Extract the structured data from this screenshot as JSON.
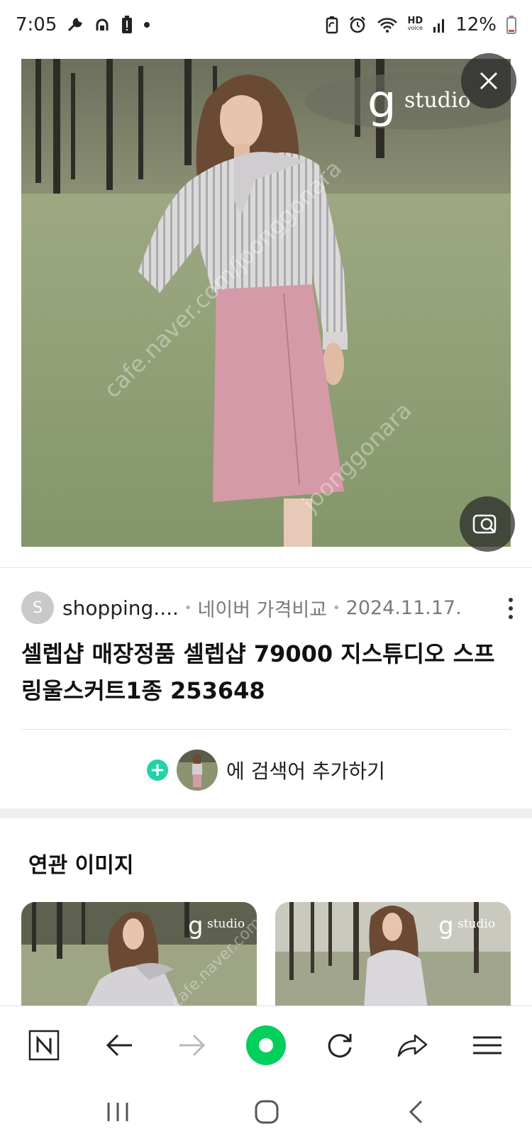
{
  "status_bar": {
    "time": "7:05",
    "battery": "12%",
    "left_icons": [
      "wrench-icon",
      "hotspot-icon",
      "battery-alert-icon",
      "dot-icon"
    ],
    "right_icons": [
      "battery-saver-icon",
      "alarm-icon",
      "wifi-icon",
      "hd-voice-icon",
      "signal-icon",
      "battery-icon"
    ],
    "hd_label": "HD",
    "voice_label": "voice"
  },
  "hero": {
    "brand_logo": "g",
    "brand_text": "studio",
    "watermark_1": "cafe.naver.com/joonggonara",
    "watermark_2": "joonggonara"
  },
  "result": {
    "favicon_letter": "S",
    "site": "shopping....",
    "source": "네이버 가격비교",
    "date": "2024.11.17.",
    "title": "셀렙샵 매장정품 셀렙샵 79000 지스튜디오 스프링울스커트1종 253648"
  },
  "add_search": {
    "label": "에 검색어 추가하기",
    "plus": "+"
  },
  "related": {
    "title": "연관 이미지",
    "brand_text": "studio",
    "watermark": "cafe.naver.com"
  },
  "colors": {
    "accent_green": "#1fd4a8",
    "naver_green": "#03cf5d",
    "skirt_pink": "#d59aa8"
  }
}
